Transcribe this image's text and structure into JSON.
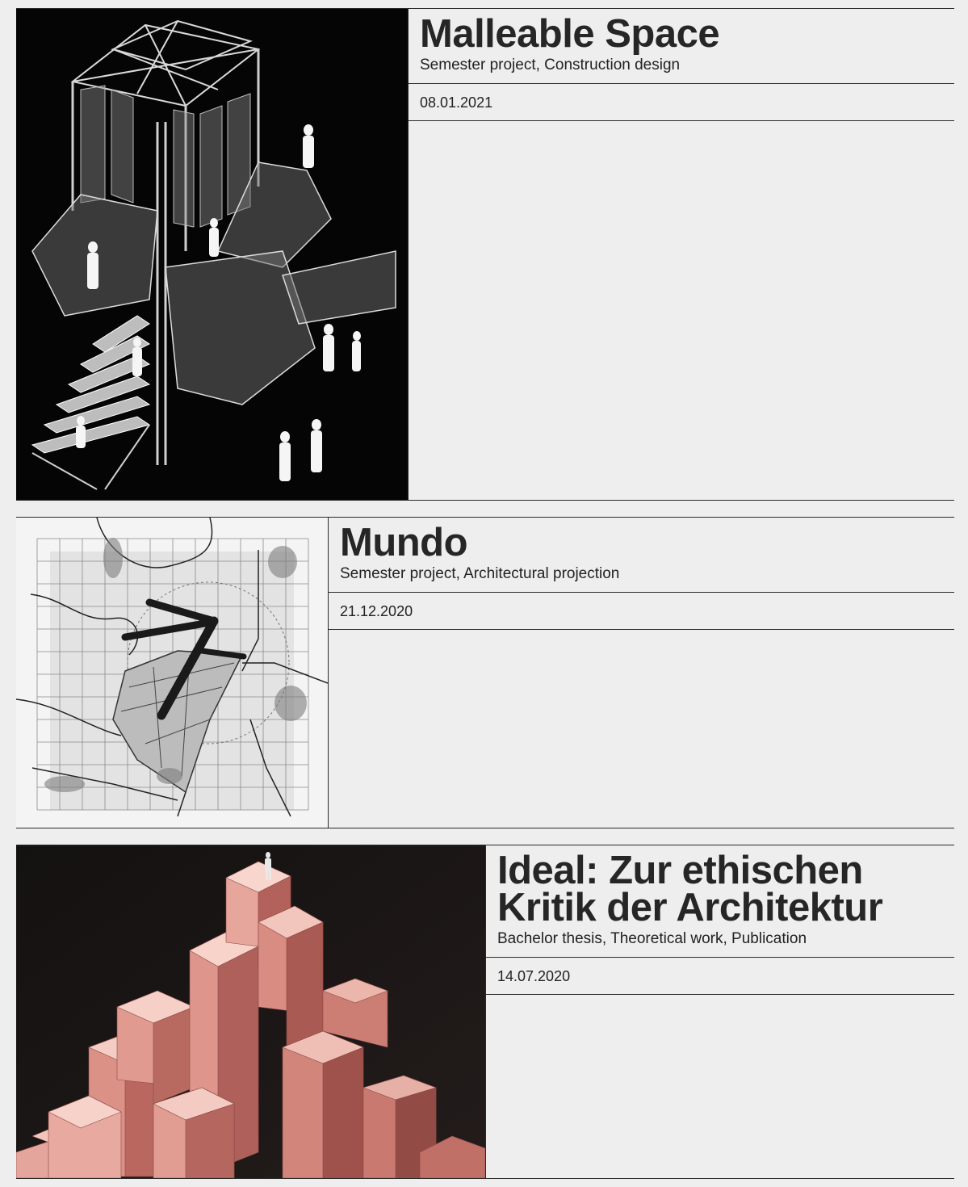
{
  "projects": [
    {
      "title": "Malleable Space",
      "subtitle": "Semester project, Construction design",
      "date": "08.01.2021"
    },
    {
      "title": "Mundo",
      "subtitle": "Semester project, Architectural projection",
      "date": "21.12.2020"
    },
    {
      "title": "Ideal: Zur ethischen Kritik der Architektur",
      "subtitle": "Bachelor thesis, Theoretical work, Publication",
      "date": "14.07.2020"
    }
  ],
  "colors": {
    "background": "#efeeee",
    "rule": "#2a2a2a",
    "thumb_dark": "#050505",
    "thumb_plan": "#f2f2f2",
    "thumb_red": "#d98a80"
  },
  "icons": {
    "project_1_image": "isometric-construction-drawing",
    "project_2_image": "site-plan-map",
    "project_3_image": "pink-stepped-mountain-render"
  }
}
